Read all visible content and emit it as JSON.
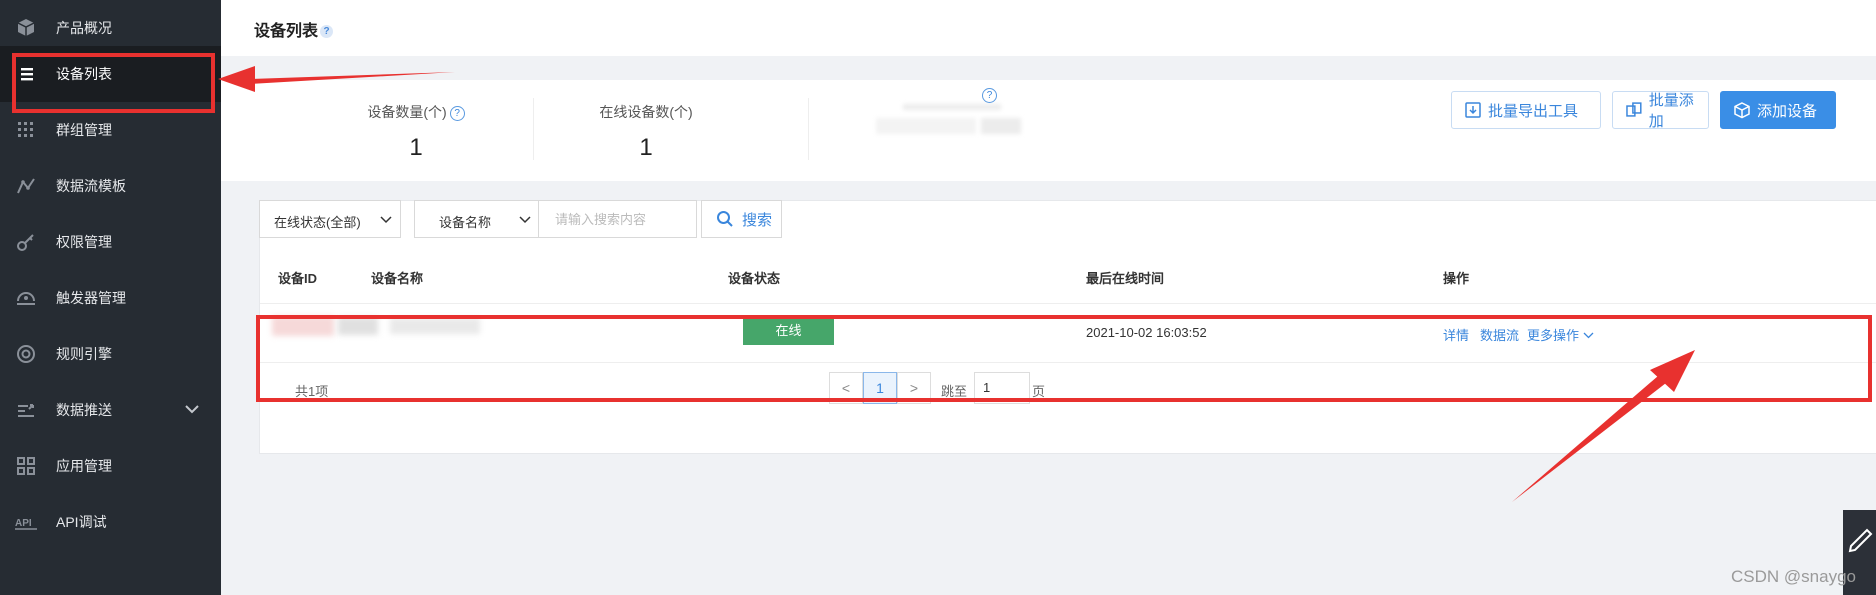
{
  "sidebar": {
    "items": [
      {
        "label": "产品概况",
        "icon": "cube-icon"
      },
      {
        "label": "设备列表",
        "icon": "list-icon",
        "active": true
      },
      {
        "label": "群组管理",
        "icon": "grid-dots-icon"
      },
      {
        "label": "数据流模板",
        "icon": "chart-line-icon"
      },
      {
        "label": "权限管理",
        "icon": "key-icon"
      },
      {
        "label": "触发器管理",
        "icon": "trigger-icon"
      },
      {
        "label": "规则引擎",
        "icon": "target-icon"
      },
      {
        "label": "数据推送",
        "icon": "push-icon",
        "has_submenu": true
      },
      {
        "label": "应用管理",
        "icon": "apps-icon"
      },
      {
        "label": "API调试",
        "icon": "api-icon"
      }
    ]
  },
  "header": {
    "title": "设备列表",
    "help": "?"
  },
  "stats": {
    "device_count_label": "设备数量(个)",
    "device_count_value": "1",
    "online_count_label": "在线设备数(个)",
    "online_count_value": "1"
  },
  "actions": {
    "export_label": "批量导出工具",
    "batch_add_label": "批量添加",
    "add_device_label": "添加设备"
  },
  "filters": {
    "status_select": "在线状态(全部)",
    "field_select": "设备名称",
    "search_placeholder": "请输入搜索内容",
    "search_button": "搜索"
  },
  "table": {
    "columns": [
      "设备ID",
      "设备名称",
      "设备状态",
      "最后在线时间",
      "操作"
    ],
    "rows": [
      {
        "status": "在线",
        "last_online": "2021-10-02 16:03:52",
        "actions": [
          "详情",
          "数据流",
          "更多操作"
        ]
      }
    ]
  },
  "pagination": {
    "total": "共1项",
    "prev": "<",
    "current_page": "1",
    "next": ">",
    "jump_label": "跳至",
    "jump_value": "1",
    "page_suffix": "页"
  },
  "watermark": "CSDN @snaygo",
  "colors": {
    "sidebar_bg": "#262c33",
    "accent": "#3a8ee6",
    "online_badge": "#46a66a",
    "annotation_red": "#e8312f"
  }
}
